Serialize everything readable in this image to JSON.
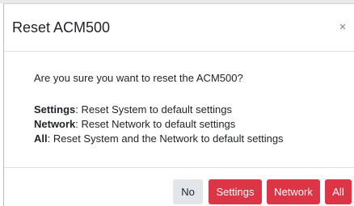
{
  "dialog": {
    "title": "Reset ACM500",
    "close_label": "×",
    "question": "Are you sure you want to reset the ACM500?",
    "options": [
      {
        "name": "Settings",
        "description": ": Reset System to default settings"
      },
      {
        "name": "Network",
        "description": ": Reset Network to default settings"
      },
      {
        "name": "All",
        "description": ": Reset System and the Network to default settings"
      }
    ],
    "buttons": {
      "no": "No",
      "settings": "Settings",
      "network": "Network",
      "all": "All"
    }
  },
  "colors": {
    "danger": "#dc3545",
    "light": "#e2e6ea",
    "text": "#212529",
    "divider": "#dee2e6"
  },
  "icons": {
    "close": "close-icon"
  }
}
